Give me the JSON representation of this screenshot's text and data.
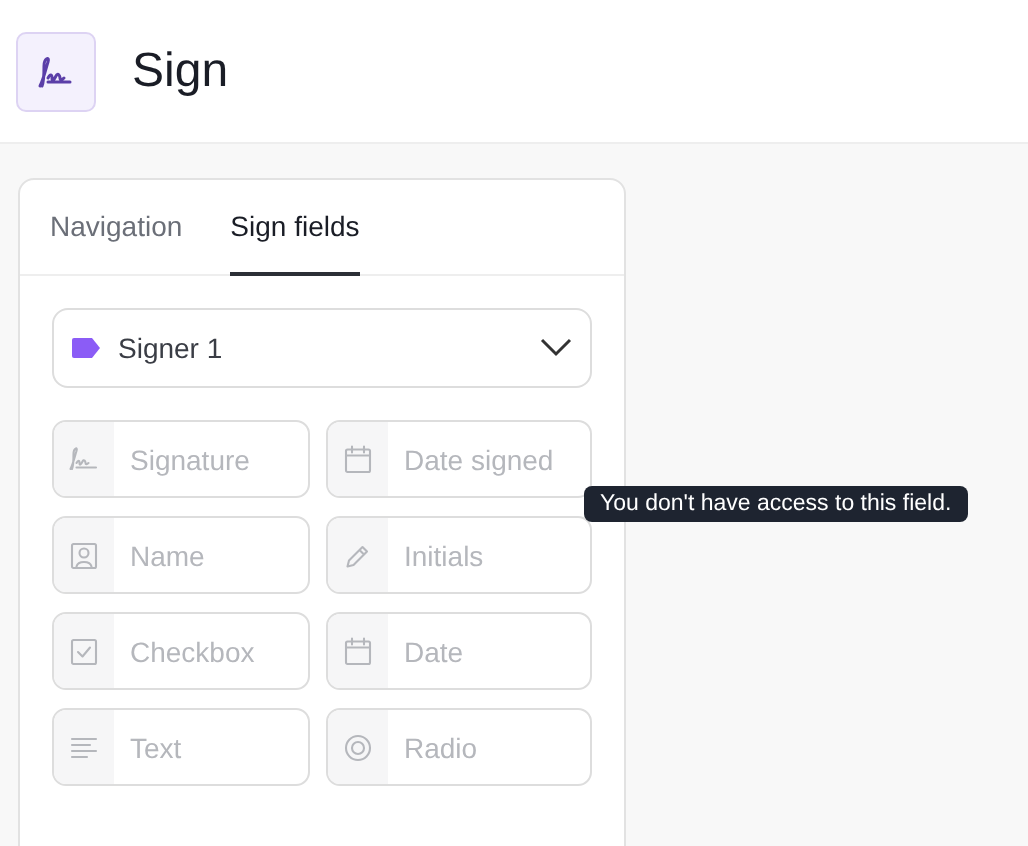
{
  "header": {
    "title": "Sign"
  },
  "tabs": [
    {
      "label": "Navigation",
      "selected": false
    },
    {
      "label": "Sign fields",
      "selected": true
    }
  ],
  "signer_select": {
    "value": "Signer 1",
    "color": "#8b5cf6"
  },
  "fields": [
    {
      "label": "Signature",
      "kind": "signature",
      "disabled": true
    },
    {
      "label": "Date signed",
      "kind": "calendar",
      "disabled": true
    },
    {
      "label": "Name",
      "kind": "person",
      "disabled": true
    },
    {
      "label": "Initials",
      "kind": "pencil",
      "disabled": true
    },
    {
      "label": "Checkbox",
      "kind": "checkbox",
      "disabled": true
    },
    {
      "label": "Date",
      "kind": "calendar",
      "disabled": true
    },
    {
      "label": "Text",
      "kind": "text",
      "disabled": true
    },
    {
      "label": "Radio",
      "kind": "radio",
      "disabled": true
    }
  ],
  "tooltip": {
    "text": "You don't have access to this field."
  }
}
